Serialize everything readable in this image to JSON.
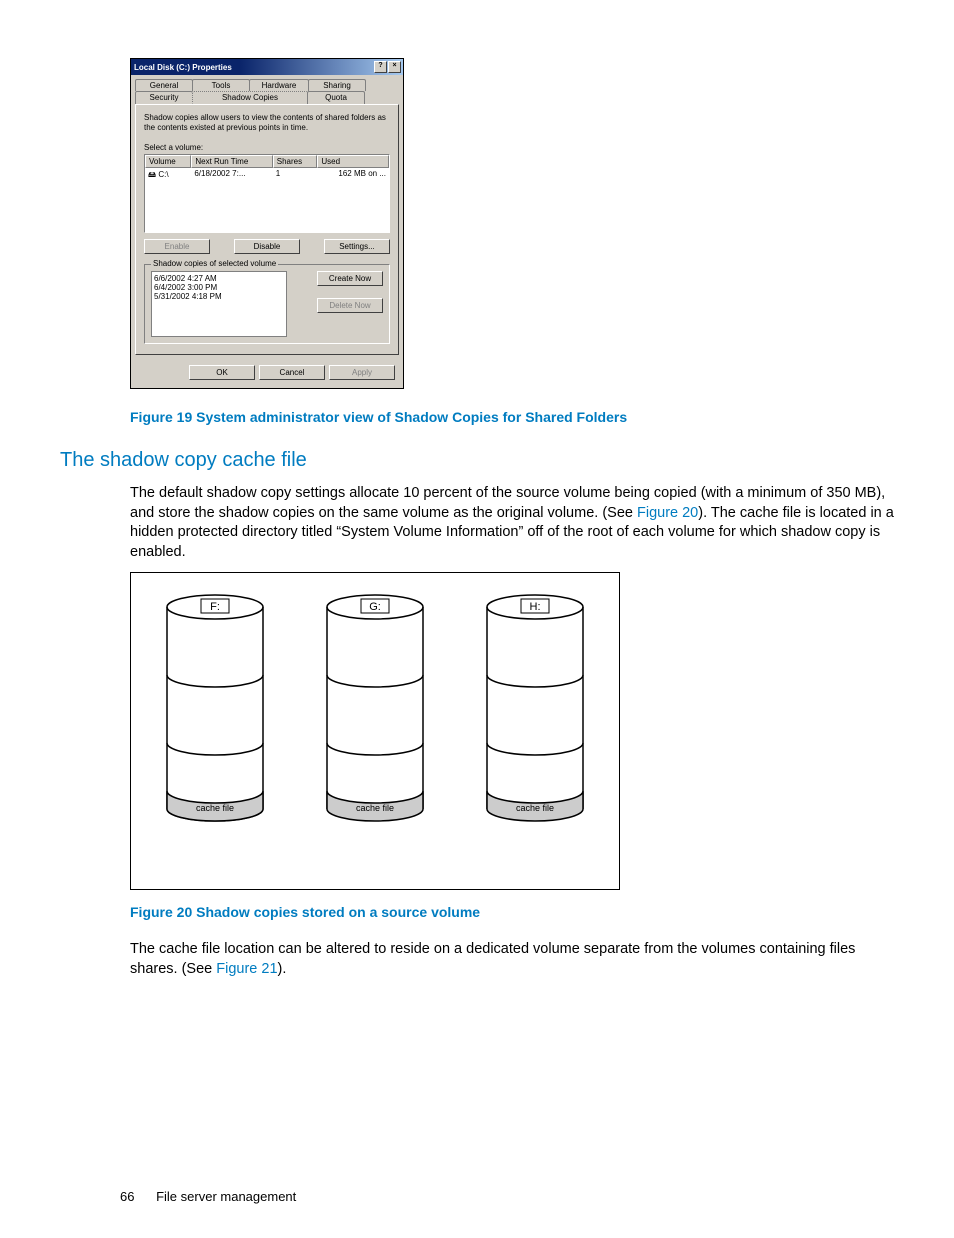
{
  "dialog": {
    "title": "Local Disk (C:) Properties",
    "help_btn": "?",
    "close_btn": "×",
    "tabs_row1": [
      "General",
      "Tools",
      "Hardware",
      "Sharing"
    ],
    "tabs_row2": [
      "Security",
      "Shadow Copies",
      "Quota"
    ],
    "desc": "Shadow copies allow users to view the contents of shared folders as the contents existed at previous points in time.",
    "select_label": "Select a volume:",
    "columns": {
      "c0": "Volume",
      "c1": "Next Run Time",
      "c2": "Shares",
      "c3": "Used"
    },
    "row": {
      "c0": "C:\\",
      "c1": "6/18/2002 7:...",
      "c2": "1",
      "c3": "162 MB on ..."
    },
    "enable_btn": "Enable",
    "disable_btn": "Disable",
    "settings_btn": "Settings...",
    "group_label": "Shadow copies of selected volume",
    "sc_list": [
      "6/6/2002 4:27 AM",
      "6/4/2002 3:00 PM",
      "5/31/2002 4:18 PM"
    ],
    "create_btn": "Create Now",
    "delete_btn": "Delete Now",
    "ok_btn": "OK",
    "cancel_btn": "Cancel",
    "apply_btn": "Apply"
  },
  "caption19": "Figure 19 System administrator view of Shadow Copies for Shared Folders",
  "section": "The shadow copy cache file",
  "para1a": "The default shadow copy settings allocate 10 percent of the source volume being copied (with a minimum of 350 MB), and store the shadow copies on the same volume as the original volume. (See ",
  "fig20link": "Figure 20",
  "para1b": "). The cache file is located in a hidden protected directory titled “System Volume Information” off of the root of each volume for which shadow copy is enabled.",
  "cyls": {
    "labels": [
      "F:",
      "G:",
      "H:"
    ],
    "cache": "cache file"
  },
  "caption20": "Figure 20 Shadow copies stored on a source volume",
  "para2a": "The cache file location can be altered to reside on a dedicated volume separate from the volumes containing files shares. (See ",
  "fig21link": "Figure 21",
  "para2b": ").",
  "footer": {
    "page": "66",
    "section": "File server management"
  }
}
